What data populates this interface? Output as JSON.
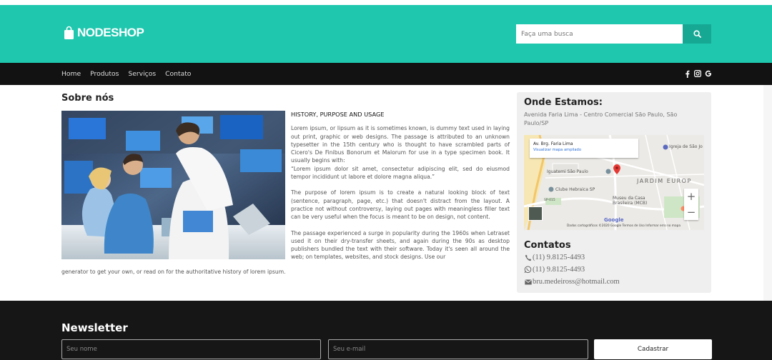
{
  "brand": {
    "logo_text": "NODESHOP",
    "accent": "#1fc7ae",
    "accent_dark": "#17a894",
    "logo_icon": "shopping-bag-icon"
  },
  "search": {
    "placeholder": "Faça uma busca",
    "button_icon": "search-icon"
  },
  "nav": {
    "items": [
      {
        "label": "Home"
      },
      {
        "label": "Produtos"
      },
      {
        "label": "Serviços"
      },
      {
        "label": "Contato"
      }
    ],
    "social_icons": [
      "facebook-icon",
      "instagram-icon",
      "google-icon"
    ]
  },
  "about": {
    "title": "Sobre nós",
    "subtitle": "HISTORY, PURPOSE AND USAGE",
    "paragraph1": "Lorem ipsum, or lipsum as it is sometimes known, is dummy text used in laying out print, graphic or web designs. The passage is attributed to an unknown typesetter in the 15th century who is thought to have scrambled parts of Cicero's De Finibus Bonorum et Malorum for use in a type specimen book. It usually begins with:",
    "quote": "“Lorem ipsum dolor sit amet, consectetur adipiscing elit, sed do eiusmod tempor incididunt ut labore et dolore magna aliqua.”",
    "paragraph2": "The purpose of lorem ipsum is to create a natural looking block of text (sentence, paragraph, page, etc.) that doesn't distract from the layout. A practice not without controversy, laying out pages with meaningless filler text can be very useful when the focus is meant to be on design, not content.",
    "paragraph3": "The passage experienced a surge in popularity during the 1960s when Letraset used it on their dry-transfer sheets, and again during the 90s as desktop publishers bundled the text with their software. Today it's seen all around the web; on templates, websites, and stock designs. Use our",
    "paragraph3_end": "generator to get your own, or read on for the authoritative history of lorem ipsum."
  },
  "location": {
    "title": "Onde Estamos:",
    "address": "Avenida Faria Lima - Centro Comercial São Paulo, São Paulo/SP",
    "map": {
      "card_title": "Av. Brg. Faria Lima",
      "card_link": "Visualizar mapa ampliado",
      "labels": {
        "hebraica": "Clube Hebraica SP",
        "iguatemi": "Iguatemi São Paulo",
        "jardim": "JARDIM EUROP",
        "museu": "Museu da Casa Brasileira (MCB)",
        "igreja": "Igreja de São Jo",
        "shield": "SP-015"
      },
      "zoom_in": "+",
      "zoom_out": "−",
      "google": "Google",
      "footer": "Dados cartográficos ©2020 Google   Termos de Uso   Informar erro no mapa"
    }
  },
  "contacts": {
    "title": "Contatos",
    "items": [
      {
        "icon": "phone-icon",
        "text": "(11) 9.8125-4493"
      },
      {
        "icon": "whatsapp-icon",
        "text": "(11) 9.8125-4493"
      },
      {
        "icon": "envelope-icon",
        "text": "bru.medeiross@hotmail.com"
      }
    ]
  },
  "newsletter": {
    "title": "Newsletter",
    "name_placeholder": "Seu nome",
    "email_placeholder": "Seu e-mail",
    "button_label": "Cadastrar"
  }
}
